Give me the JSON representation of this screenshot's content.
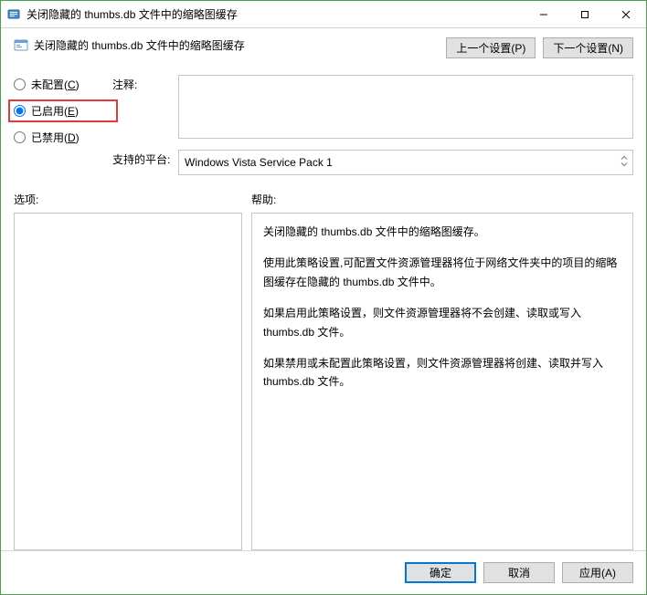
{
  "window": {
    "title": "关闭隐藏的 thumbs.db 文件中的缩略图缓存"
  },
  "header": {
    "title": "关闭隐藏的 thumbs.db 文件中的缩略图缓存",
    "prev": "上一个设置(P)",
    "next": "下一个设置(N)"
  },
  "radios": {
    "not_configured": {
      "text": "未配置(",
      "acc": "C",
      "suffix": ")"
    },
    "enabled": {
      "text": "已启用(",
      "acc": "E",
      "suffix": ")"
    },
    "disabled": {
      "text": "已禁用(",
      "acc": "D",
      "suffix": ")"
    }
  },
  "fields": {
    "comment_label": "注释:",
    "comment_value": "",
    "platform_label": "支持的平台:",
    "platform_value": "Windows Vista Service Pack 1"
  },
  "labels": {
    "options": "选项:",
    "help": "帮助:"
  },
  "help": {
    "p1": "关闭隐藏的 thumbs.db 文件中的缩略图缓存。",
    "p2": "使用此策略设置,可配置文件资源管理器将位于网络文件夹中的项目的缩略图缓存在隐藏的 thumbs.db 文件中。",
    "p3": "如果启用此策略设置，则文件资源管理器将不会创建、读取或写入 thumbs.db 文件。",
    "p4": "如果禁用或未配置此策略设置，则文件资源管理器将创建、读取并写入 thumbs.db 文件。"
  },
  "footer": {
    "ok": "确定",
    "cancel": "取消",
    "apply": "应用(A)"
  }
}
